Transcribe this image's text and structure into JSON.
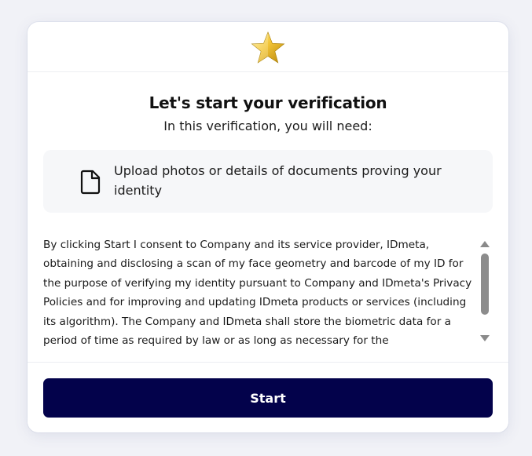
{
  "header": {
    "logo_icon": "gold-star-icon",
    "accent_color": "#e6b422"
  },
  "main": {
    "title": "Let's start your verification",
    "subtitle": "In this verification, you will need:",
    "requirement": {
      "icon": "document-icon",
      "text": "Upload photos or details of documents proving your identity"
    },
    "consent_text": "By clicking Start I consent to Company and its service provider, IDmeta, obtaining and disclosing a scan of my face geometry and barcode of my ID for the purpose of verifying my identity pursuant to Company and IDmeta's Privacy Policies and for improving and updating IDmeta products or services (including its algorithm). The Company and IDmeta shall store the biometric data for a period of time as required by law or as long as necessary for the"
  },
  "footer": {
    "start_label": "Start",
    "button_color": "#03024b"
  }
}
